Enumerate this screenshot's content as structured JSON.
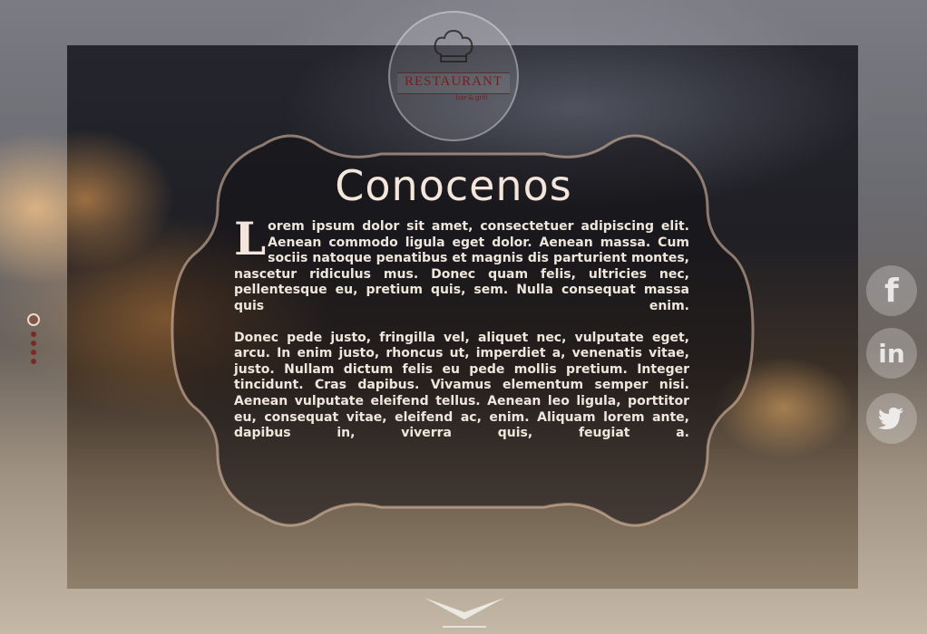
{
  "logo": {
    "title": "RESTAURANT",
    "subtitle": "bar & grill"
  },
  "section": {
    "heading": "Conocenos",
    "dropcap": "L",
    "paragraph1": "orem ipsum dolor sit amet, consectetuer adipiscing elit. Aenean commodo ligula eget dolor. Aenean massa. Cum sociis natoque penatibus et magnis dis parturient montes, nascetur ridiculus mus. Donec quam felis, ultricies nec, pellentesque eu, pretium quis, sem. Nulla consequat massa quis enim.",
    "paragraph2": "Donec pede justo, fringilla vel, aliquet nec, vulputate eget, arcu. In enim justo, rhoncus ut, imperdiet a, venenatis vitae, justo. Nullam dictum felis eu pede mollis pretium. Integer tincidunt. Cras dapibus. Vivamus elementum semper nisi. Aenean vulputate eleifend tellus. Aenean leo ligula, porttitor eu, consequat vitae, eleifend ac, enim. Aliquam lorem ante, dapibus in, viverra quis, feugiat a."
  },
  "social": {
    "facebook_icon": "f",
    "linkedin_icon": "in",
    "twitter_icon": "twitter-bird"
  },
  "nav": {
    "active_index": 1,
    "dot_count": 5
  },
  "colors": {
    "accent": "#7e1a1a",
    "text": "#efe6dc"
  }
}
